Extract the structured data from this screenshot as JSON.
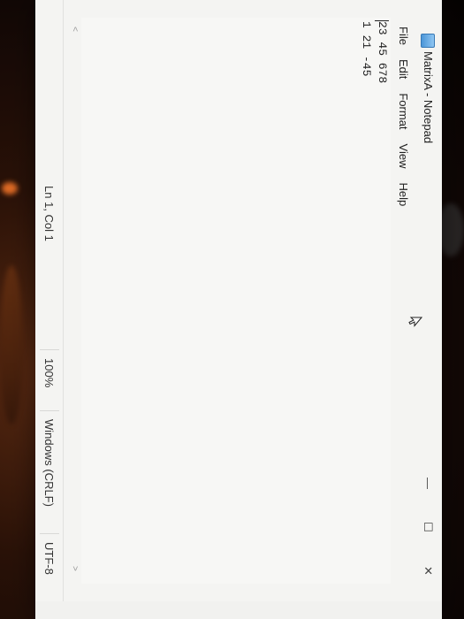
{
  "window": {
    "title": "MatrixA - Notepad",
    "controls": {
      "minimize": "—",
      "maximize": "☐",
      "close": "✕"
    }
  },
  "menu": {
    "file": "File",
    "edit": "Edit",
    "format": "Format",
    "view": "View",
    "help": "Help"
  },
  "editor": {
    "lines": [
      "23 45 678",
      "1 21 -45"
    ]
  },
  "scroll": {
    "left_arrow": "<",
    "right_arrow": ">"
  },
  "statusbar": {
    "position": "Ln 1, Col 1",
    "zoom": "100%",
    "line_ending": "Windows (CRLF)",
    "encoding": "UTF-8"
  }
}
